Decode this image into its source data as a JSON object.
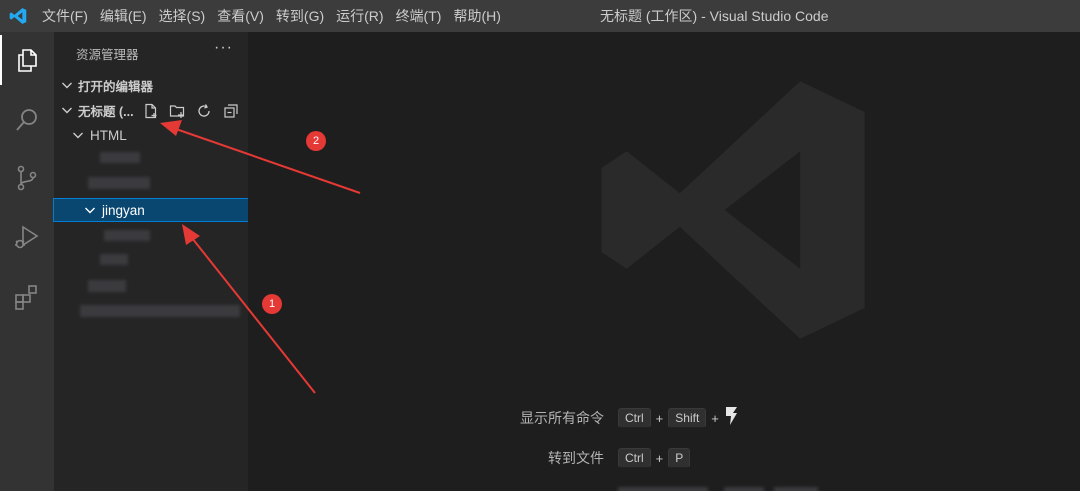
{
  "menu": [
    "文件(F)",
    "编辑(E)",
    "选择(S)",
    "查看(V)",
    "转到(G)",
    "运行(R)",
    "终端(T)",
    "帮助(H)"
  ],
  "window_title": "无标题 (工作区) - Visual Studio Code",
  "sidebar": {
    "title": "资源管理器",
    "more": "···",
    "open_editors": "打开的编辑器",
    "workspace": "无标题 (...",
    "folders": {
      "html": "HTML",
      "jingyan": "jingyan"
    }
  },
  "shortcuts": [
    {
      "label": "显示所有命令",
      "keys": [
        "Ctrl",
        "Shift"
      ]
    },
    {
      "label": "转到文件",
      "keys": [
        "Ctrl",
        "P"
      ]
    }
  ],
  "annotations": {
    "marker1": "1",
    "marker2": "2"
  },
  "colors": {
    "titlebar": "#3c3c3c",
    "activity": "#333333",
    "sidebar": "#252526",
    "editor": "#1e1e1e",
    "selection": "#094771",
    "accent": "#007acc",
    "annotation": "#e53935"
  }
}
